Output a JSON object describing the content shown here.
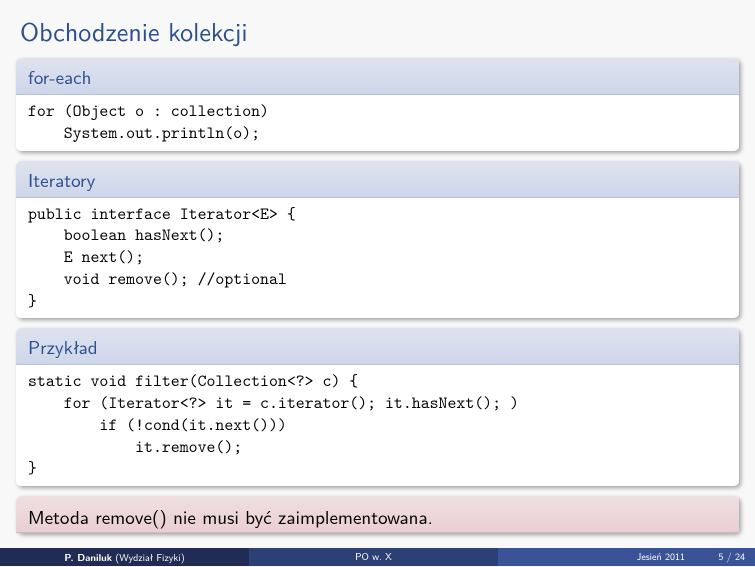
{
  "title": "Obchodzenie kolekcji",
  "block1": {
    "head": "for-each",
    "code": "for (Object o : collection)\n    System.out.println(o);"
  },
  "block2": {
    "head": "Iteratory",
    "code": "public interface Iterator<E> {\n    boolean hasNext();\n    E next();\n    void remove(); //optional\n}"
  },
  "block3": {
    "head": "Przykład",
    "code": "static void filter(Collection<?> c) {\n    for (Iterator<?> it = c.iterator(); it.hasNext(); )\n        if (!cond(it.next()))\n            it.remove();\n}"
  },
  "block4": {
    "text": "Metoda remove() nie musi być zaimplementowana."
  },
  "footer": {
    "author": "P. Daniluk",
    "affiliation": "(Wydział Fizyki)",
    "center": "PO w. X",
    "date": "Jesień 2011",
    "page": "5 / 24"
  }
}
